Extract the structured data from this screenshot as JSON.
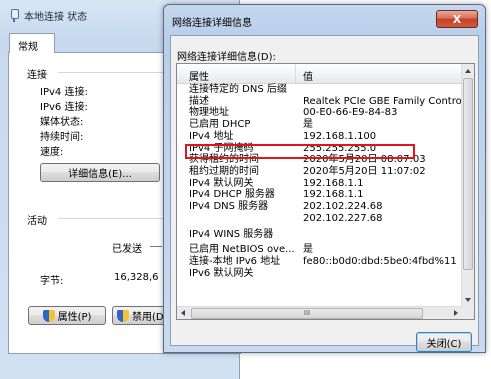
{
  "background_window": {
    "title": "本地连接 状态",
    "tab": "常规",
    "connection_heading": "连接",
    "fields": [
      {
        "label": "IPv4 连接:"
      },
      {
        "label": "IPv6 连接:"
      },
      {
        "label": "媒体状态:"
      },
      {
        "label": "持续时间:"
      },
      {
        "label": "速度:"
      }
    ],
    "details_button": "详细信息(E)...",
    "activity_heading": "活动",
    "sent_label": "已发送",
    "bytes_label": "字节:",
    "bytes_value": "16,328,6",
    "properties_button": "属性(P)",
    "disable_button": "禁用(D"
  },
  "dialog": {
    "title": "网络连接详细信息",
    "close_icon_label": "X",
    "details_label": "网络连接详细信息(D):",
    "columns": {
      "property": "属性",
      "value": "值"
    },
    "rows": [
      {
        "property": "连接特定的 DNS 后缀",
        "value": ""
      },
      {
        "property": "描述",
        "value": "Realtek PCIe GBE Family Contro"
      },
      {
        "property": "物理地址",
        "value": "00-E0-66-E9-84-83"
      },
      {
        "property": "已启用 DHCP",
        "value": "是"
      },
      {
        "property": "IPv4 地址",
        "value": "192.168.1.100"
      },
      {
        "property": "IPv4 子网掩码",
        "value": "255.255.255.0"
      },
      {
        "property": "获得租约的时间",
        "value": "2020年5月20日 08:07:03"
      },
      {
        "property": "租约过期的时间",
        "value": "2020年5月20日 11:07:02"
      },
      {
        "property": "IPv4 默认网关",
        "value": "192.168.1.1"
      },
      {
        "property": "IPv4 DHCP 服务器",
        "value": "192.168.1.1"
      },
      {
        "property": "IPv4 DNS 服务器",
        "value": "202.102.224.68"
      },
      {
        "property": "",
        "value": "202.102.227.68"
      },
      {
        "property": "IPv4 WINS 服务器",
        "value": ""
      },
      {
        "property": "已启用 NetBIOS ove...",
        "value": "是"
      },
      {
        "property": "连接-本地 IPv6 地址",
        "value": "fe80::b0d0:dbd:5be0:4fbd%11"
      },
      {
        "property": "IPv6 默认网关",
        "value": ""
      }
    ],
    "hscroll_grip": "III",
    "close_button": "关闭(C)"
  }
}
